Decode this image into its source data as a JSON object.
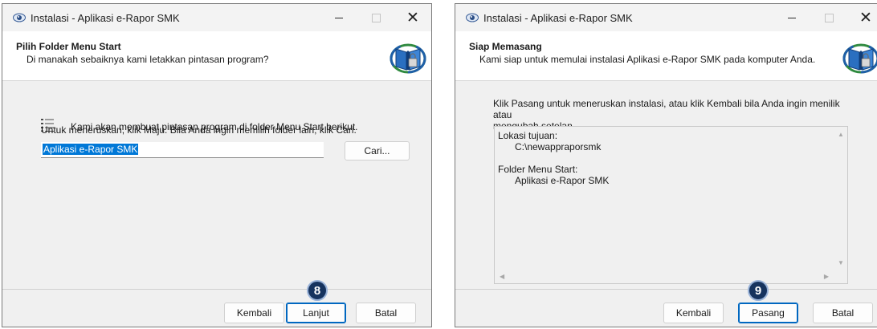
{
  "window1": {
    "title": "Instalasi - Aplikasi e-Rapor SMK",
    "header_title": "Pilih Folder Menu Start",
    "header_subtitle": "Di manakah sebaiknya kami letakkan pintasan program?",
    "info_line": "Kami akan membuat pintasan program di folder Menu Start berikut.",
    "instruction": "Untuk meneruskan, klik Maju. Bila Anda ingin memilih folder lain, klik Cari.",
    "folder_value": "Aplikasi e-Rapor SMK",
    "browse_label": "Cari...",
    "back_label": "Kembali",
    "next_label": "Lanjut",
    "cancel_label": "Batal",
    "step_badge": "8"
  },
  "window2": {
    "title": "Instalasi - Aplikasi e-Rapor SMK",
    "header_title": "Siap Memasang",
    "header_subtitle": "Kami siap untuk memulai instalasi Aplikasi e-Rapor SMK pada komputer Anda.",
    "info_line1": "Klik Pasang untuk meneruskan instalasi, atau klik Kembali bila Anda ingin menilik atau",
    "info_line2": "mengubah setelan.",
    "memo": {
      "dest_label": "Lokasi tujuan:",
      "dest_value": "C:\\newappraporsmk",
      "menu_label": "Folder Menu Start:",
      "menu_value": "Aplikasi e-Rapor SMK"
    },
    "back_label": "Kembali",
    "install_label": "Pasang",
    "cancel_label": "Batal",
    "step_badge": "9"
  },
  "icons": {
    "app": "eye-app-icon",
    "logo": "setup-book-logo",
    "list": "list-icon",
    "close": "close-icon"
  },
  "colors": {
    "accent": "#0067c0",
    "selection": "#0078d7",
    "badge": "#16335e"
  }
}
